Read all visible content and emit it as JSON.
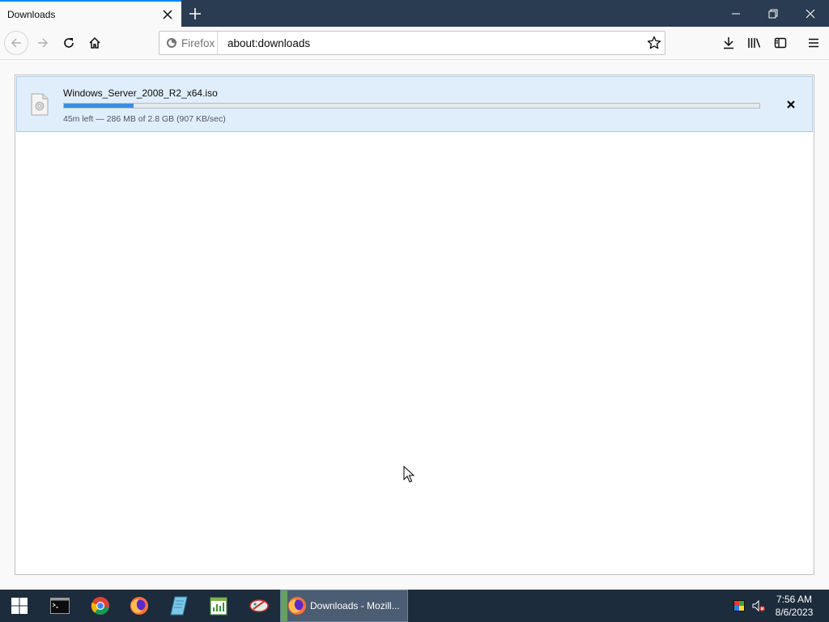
{
  "tab": {
    "title": "Downloads"
  },
  "urlbar": {
    "identity_label": "Firefox",
    "url": "about:downloads"
  },
  "download": {
    "filename": "Windows_Server_2008_R2_x64.iso",
    "progress_fraction": 0.1,
    "status": "45m left — 286 MB of 2.8 GB (907 KB/sec)"
  },
  "taskbar": {
    "active_app_label": "Downloads - Mozill...",
    "time": "7:56 AM",
    "date": "8/6/2023"
  },
  "colors": {
    "accent": "#0a84ff",
    "progress": "#3a8ce4",
    "titlebar": "#2a3c52",
    "taskbar": "#1c2c3c"
  }
}
